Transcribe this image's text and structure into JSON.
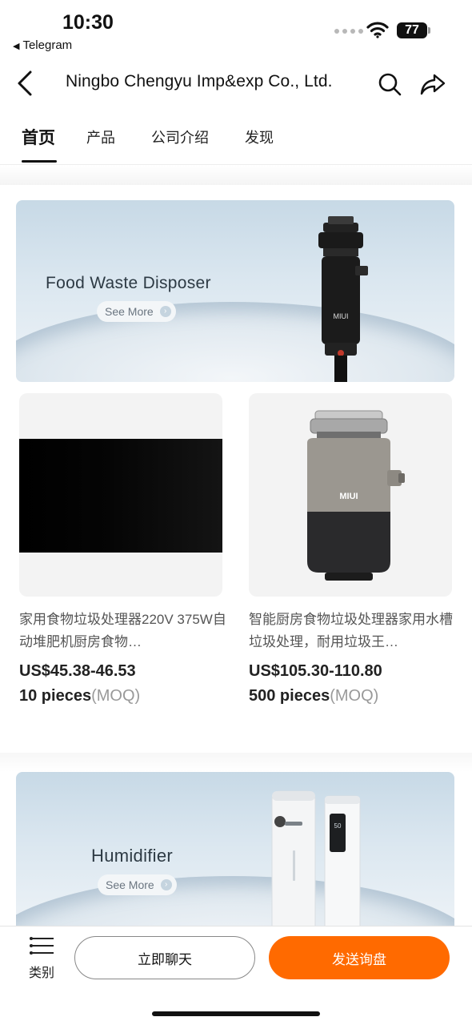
{
  "status_bar": {
    "time": "10:30",
    "back_app": "Telegram",
    "battery": "77"
  },
  "header": {
    "title": "Ningbo Chengyu Imp&exp Co., Ltd."
  },
  "tabs": [
    {
      "label": "首页",
      "active": true
    },
    {
      "label": "产品",
      "active": false
    },
    {
      "label": "公司介绍",
      "active": false
    },
    {
      "label": "发现",
      "active": false
    }
  ],
  "banners": [
    {
      "caption": "Food Waste Disposer",
      "brand": "MIUI",
      "button": "See More"
    },
    {
      "caption": "Humidifier",
      "button": "See More"
    }
  ],
  "products": [
    {
      "name": "家用食物垃圾处理器220V 375W自动堆肥机厨房食物…",
      "price": "US$45.38-46.53",
      "moq_qty": "10 pieces",
      "moq_label": "(MOQ)"
    },
    {
      "name": "智能厨房食物垃圾处理器家用水槽垃圾处理，耐用垃圾王…",
      "price": "US$105.30-110.80",
      "moq_qty": "500 pieces",
      "moq_label": "(MOQ)",
      "brand": "MIUI"
    }
  ],
  "humidifier_display": "50",
  "bottom_bar": {
    "category": "类别",
    "chat": "立即聊天",
    "inquiry": "发送询盘"
  },
  "colors": {
    "accent": "#ff6a00",
    "banner_bg": "#d3e2ec"
  }
}
